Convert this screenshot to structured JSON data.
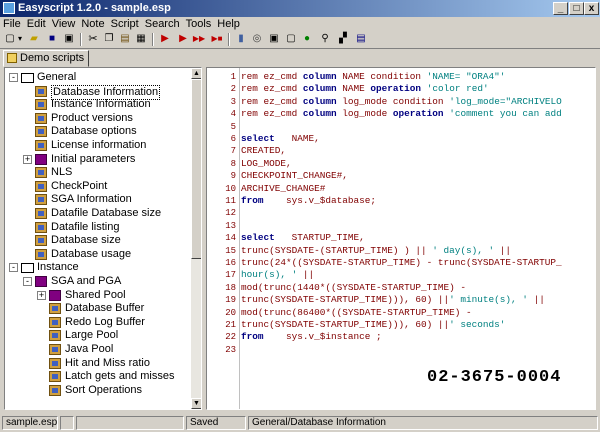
{
  "window": {
    "title": "Easyscript 1.2.0 - sample.esp",
    "controls": [
      "_",
      "□",
      "x"
    ]
  },
  "menu": [
    "File",
    "Edit",
    "View",
    "Note",
    "Script",
    "Search",
    "Tools",
    "Help"
  ],
  "toolbar_icons": [
    "new-icon",
    "open-icon",
    "save-icon",
    "save-as-icon",
    "print-icon",
    "cut-icon",
    "copy-icon",
    "paste-icon",
    "clipboard-icon",
    "run-icon",
    "play-icon",
    "step-icon",
    "stop-icon",
    "database-icon",
    "network-icon",
    "properties-icon",
    "window-icon",
    "refresh-icon",
    "binoculars-icon",
    "find-icon",
    "help-icon"
  ],
  "tabs": [
    {
      "label": "Demo scripts"
    }
  ],
  "tree": [
    {
      "label": "General",
      "level": 0,
      "type": "folder",
      "expander": "-"
    },
    {
      "label": "Database Information",
      "level": 1,
      "type": "item",
      "selected": true
    },
    {
      "label": "Instance Information",
      "level": 1,
      "type": "item"
    },
    {
      "label": "Product versions",
      "level": 1,
      "type": "item"
    },
    {
      "label": "Database options",
      "level": 1,
      "type": "item"
    },
    {
      "label": "License information",
      "level": 1,
      "type": "item"
    },
    {
      "label": "Initial parameters",
      "level": 1,
      "type": "book",
      "expander": "+"
    },
    {
      "label": "NLS",
      "level": 1,
      "type": "item"
    },
    {
      "label": "CheckPoint",
      "level": 1,
      "type": "item"
    },
    {
      "label": "SGA Information",
      "level": 1,
      "type": "item"
    },
    {
      "label": "Datafile Database size",
      "level": 1,
      "type": "item"
    },
    {
      "label": "Datafile listing",
      "level": 1,
      "type": "item"
    },
    {
      "label": "Database size",
      "level": 1,
      "type": "item"
    },
    {
      "label": "Database usage",
      "level": 1,
      "type": "item"
    },
    {
      "label": "Instance",
      "level": 0,
      "type": "folder",
      "expander": "-"
    },
    {
      "label": "SGA and PGA",
      "level": 1,
      "type": "book",
      "expander": "-"
    },
    {
      "label": "Shared Pool",
      "level": 2,
      "type": "book",
      "expander": "+"
    },
    {
      "label": "Database Buffer",
      "level": 2,
      "type": "item"
    },
    {
      "label": "Redo Log Buffer",
      "level": 2,
      "type": "item"
    },
    {
      "label": "Large Pool",
      "level": 2,
      "type": "item"
    },
    {
      "label": "Java Pool",
      "level": 2,
      "type": "item"
    },
    {
      "label": "Hit and Miss ratio",
      "level": 2,
      "type": "item"
    },
    {
      "label": "Latch gets and misses",
      "level": 2,
      "type": "item"
    },
    {
      "label": "Sort Operations",
      "level": 2,
      "type": "item"
    }
  ],
  "code": [
    [
      {
        "t": "rem ez_cmd "
      },
      {
        "t": "column",
        "c": "kw"
      },
      {
        "t": " NAME condition "
      },
      {
        "t": "'NAME= \"ORA4\"'",
        "c": "str"
      }
    ],
    [
      {
        "t": "rem ez_cmd "
      },
      {
        "t": "column",
        "c": "kw"
      },
      {
        "t": " NAME "
      },
      {
        "t": "operation",
        "c": "kw"
      },
      {
        "t": " "
      },
      {
        "t": "'color red'",
        "c": "str"
      }
    ],
    [
      {
        "t": "rem ez_cmd "
      },
      {
        "t": "column",
        "c": "kw"
      },
      {
        "t": " log_mode condition "
      },
      {
        "t": "'log_mode=\"ARCHIVELO",
        "c": "str"
      }
    ],
    [
      {
        "t": "rem ez_cmd "
      },
      {
        "t": "column",
        "c": "kw"
      },
      {
        "t": " log_mode "
      },
      {
        "t": "operation",
        "c": "kw"
      },
      {
        "t": " "
      },
      {
        "t": "'comment you can add",
        "c": "str"
      }
    ],
    [
      {
        "t": ""
      }
    ],
    [
      {
        "t": "select",
        "c": "kw"
      },
      {
        "t": "   NAME,"
      }
    ],
    [
      {
        "t": "CREATED,"
      }
    ],
    [
      {
        "t": "LOG_MODE,"
      }
    ],
    [
      {
        "t": "CHECKPOINT_CHANGE#,"
      }
    ],
    [
      {
        "t": "ARCHIVE_CHANGE#"
      }
    ],
    [
      {
        "t": "from",
        "c": "kw"
      },
      {
        "t": "    sys.v_$database;"
      }
    ],
    [
      {
        "t": ""
      }
    ],
    [
      {
        "t": ""
      }
    ],
    [
      {
        "t": "select",
        "c": "kw"
      },
      {
        "t": "   STARTUP_TIME,"
      }
    ],
    [
      {
        "t": "trunc(SYSDATE-(STARTUP_TIME) ) || "
      },
      {
        "t": "' day(s), '",
        "c": "str"
      },
      {
        "t": " ||"
      }
    ],
    [
      {
        "t": "trunc(24*((SYSDATE-STARTUP_TIME) - trunc(SYSDATE-STARTUP_"
      }
    ],
    [
      {
        "t": "hour(s), '",
        "c": "str"
      },
      {
        "t": " ||"
      }
    ],
    [
      {
        "t": "mod(trunc(1440*((SYSDATE-STARTUP_TIME) -"
      }
    ],
    [
      {
        "t": "trunc(SYSDATE-STARTUP_TIME))), 60) ||"
      },
      {
        "t": "' minute(s), '",
        "c": "str"
      },
      {
        "t": " ||"
      }
    ],
    [
      {
        "t": "mod(trunc(86400*((SYSDATE-STARTUP_TIME) -"
      }
    ],
    [
      {
        "t": "trunc(SYSDATE-STARTUP_TIME))), 60) ||"
      },
      {
        "t": "' seconds'",
        "c": "str"
      }
    ],
    [
      {
        "t": "from",
        "c": "kw"
      },
      {
        "t": "    sys.v_$instance ;"
      }
    ],
    [
      {
        "t": ""
      }
    ]
  ],
  "overlay_text": "02-3675-0004",
  "status": {
    "file": "sample.esp",
    "state": "Saved",
    "path": "General/Database Information"
  }
}
